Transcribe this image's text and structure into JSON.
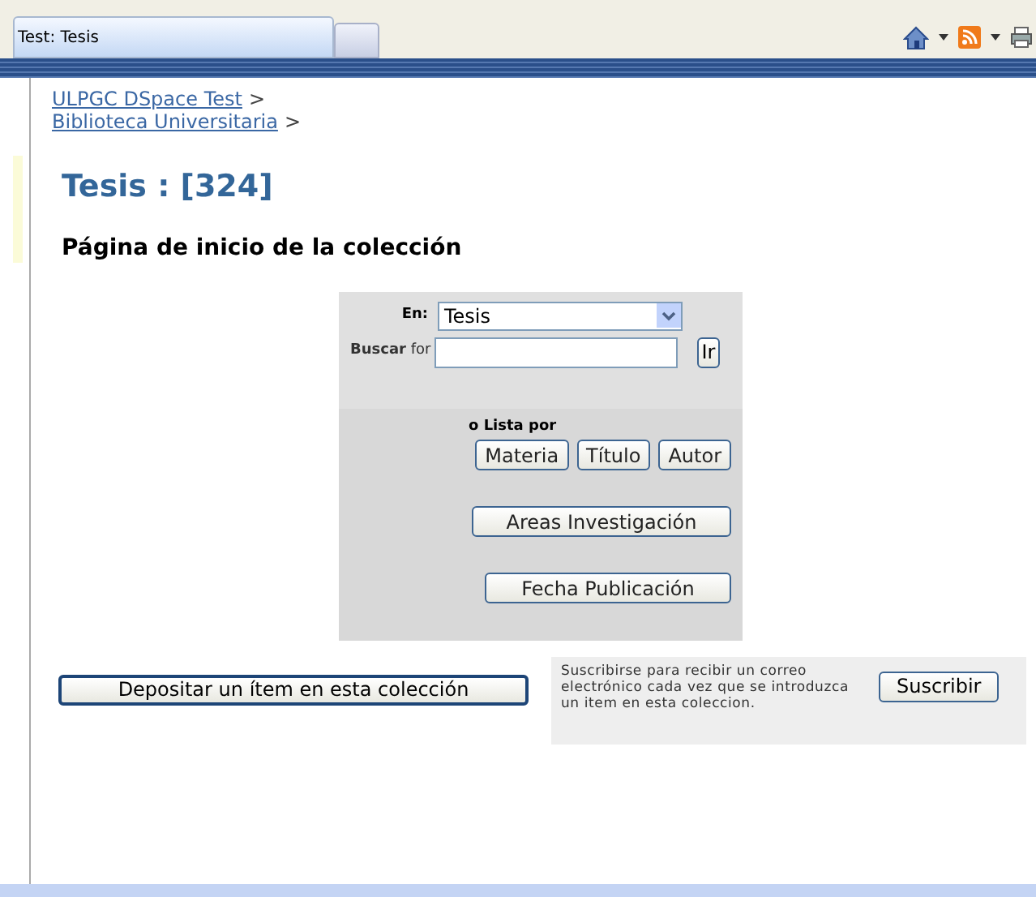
{
  "browser": {
    "tabs": [
      {
        "label": "Test: Tesis",
        "selected": true
      },
      {
        "selected": false
      }
    ]
  },
  "breadcrumbs": [
    {
      "label": "ULPGC DSpace Test",
      "separator": ">"
    },
    {
      "label": "Biblioteca Universitaria",
      "separator": ">"
    }
  ],
  "title": "Tesis : [324]",
  "subtitle": "Página de inicio de la colección",
  "search": {
    "scope_label": "En:",
    "scope_value": "Tesis",
    "query_label": "**Buscar** for",
    "go_button": "Ir"
  },
  "browse": {
    "label": "o Lista por",
    "buttons": [
      [
        "Materia",
        "Título",
        "Autor"
      ],
      [
        "Areas Investigación"
      ],
      [
        "Fecha Publicación"
      ]
    ]
  },
  "submit_button": "Depositar un ítem en esta colección",
  "subscribe": {
    "text": "Suscribirse para recibir un correo electrónico cada vez que se introduzca un item en esta coleccion.",
    "button": "Suscribir"
  }
}
